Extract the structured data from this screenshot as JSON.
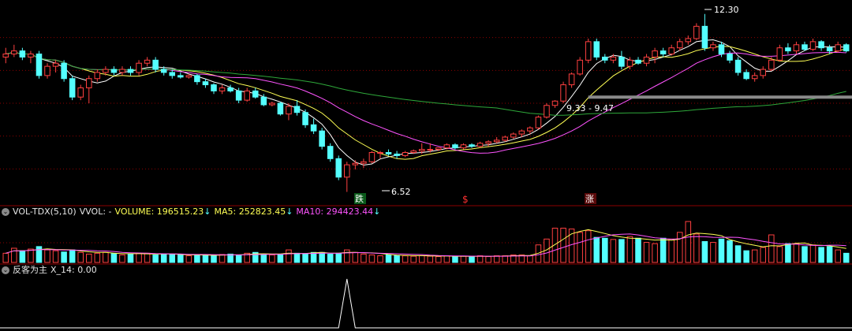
{
  "volume_panel": {
    "title": "VOL-TDX(5,10)",
    "vvol": "VVOL: -",
    "volume": "VOLUME: 196515.23",
    "ma5": "MA5: 252823.45",
    "ma10": "MA10: 294423.44",
    "arrow": "↓",
    "colors": {
      "title": "#e6e6e6",
      "volume": "#ffff54",
      "ma5": "#ffff54",
      "ma10": "#ff54ff",
      "arrow": "#54ffff"
    }
  },
  "signal_panel": {
    "title": "反客为主",
    "value": "X_14: 0.00"
  },
  "annotations": {
    "high_label": "12.30",
    "low_label": "6.52",
    "range_label": "9.33 - 9.47",
    "marker_down": "跌",
    "marker_dollar": "$",
    "marker_up": "涨"
  },
  "colors": {
    "up": "#ff4040",
    "down": "#54ffff",
    "ma_white": "#ffffff",
    "ma_yellow": "#ffff54",
    "ma_magenta": "#ff54ff",
    "ma_green": "#2ea83a",
    "grid": "#8b0000"
  },
  "chart_data": {
    "type": "candlestick",
    "price_candles": [
      [
        10.9,
        11.2,
        10.7,
        11.0
      ],
      [
        11.0,
        11.3,
        10.9,
        11.1
      ],
      [
        11.1,
        11.2,
        10.8,
        10.9
      ],
      [
        10.9,
        11.1,
        10.7,
        11.0
      ],
      [
        11.0,
        11.1,
        10.2,
        10.3
      ],
      [
        10.3,
        10.7,
        10.2,
        10.6
      ],
      [
        10.6,
        10.8,
        10.4,
        10.7
      ],
      [
        10.7,
        10.8,
        10.1,
        10.2
      ],
      [
        10.2,
        10.3,
        9.5,
        9.6
      ],
      [
        9.6,
        10.0,
        9.5,
        9.9
      ],
      [
        9.9,
        10.3,
        9.4,
        10.2
      ],
      [
        10.2,
        10.5,
        10.1,
        10.4
      ],
      [
        10.4,
        10.6,
        10.3,
        10.5
      ],
      [
        10.5,
        10.6,
        10.3,
        10.4
      ],
      [
        10.4,
        10.6,
        10.3,
        10.5
      ],
      [
        10.5,
        10.6,
        10.3,
        10.4
      ],
      [
        10.4,
        10.8,
        10.3,
        10.7
      ],
      [
        10.7,
        10.9,
        10.6,
        10.8
      ],
      [
        10.8,
        10.9,
        10.4,
        10.5
      ],
      [
        10.5,
        10.6,
        10.3,
        10.4
      ],
      [
        10.4,
        10.5,
        10.2,
        10.3
      ],
      [
        10.3,
        10.4,
        10.2,
        10.25
      ],
      [
        10.25,
        10.35,
        10.2,
        10.3
      ],
      [
        10.3,
        10.35,
        10.0,
        10.1
      ],
      [
        10.1,
        10.2,
        9.9,
        10.0
      ],
      [
        10.0,
        10.05,
        9.7,
        9.8
      ],
      [
        9.8,
        10.0,
        9.7,
        9.9
      ],
      [
        9.9,
        10.0,
        9.75,
        9.8
      ],
      [
        9.8,
        9.9,
        9.4,
        9.5
      ],
      [
        9.5,
        9.9,
        9.45,
        9.8
      ],
      [
        9.8,
        9.9,
        9.55,
        9.6
      ],
      [
        9.6,
        9.7,
        9.3,
        9.35
      ],
      [
        9.35,
        9.45,
        9.3,
        9.4
      ],
      [
        9.4,
        9.45,
        9.0,
        9.05
      ],
      [
        9.05,
        9.4,
        8.85,
        9.3
      ],
      [
        9.3,
        9.5,
        9.0,
        9.1
      ],
      [
        9.1,
        9.2,
        8.6,
        8.7
      ],
      [
        8.7,
        8.9,
        8.4,
        8.5
      ],
      [
        8.5,
        8.6,
        7.9,
        8.0
      ],
      [
        8.0,
        8.1,
        7.5,
        7.6
      ],
      [
        7.6,
        7.7,
        6.9,
        7.0
      ],
      [
        7.0,
        7.5,
        6.52,
        7.4
      ],
      [
        7.4,
        7.55,
        7.25,
        7.45
      ],
      [
        7.45,
        7.6,
        7.3,
        7.5
      ],
      [
        7.5,
        7.85,
        7.45,
        7.8
      ],
      [
        7.8,
        7.85,
        7.6,
        7.8
      ],
      [
        7.8,
        7.9,
        7.7,
        7.75
      ],
      [
        7.75,
        7.85,
        7.6,
        7.7
      ],
      [
        7.7,
        7.85,
        7.65,
        7.8
      ],
      [
        7.8,
        7.9,
        7.75,
        7.85
      ],
      [
        7.85,
        8.1,
        7.75,
        7.9
      ],
      [
        7.9,
        8.1,
        7.8,
        7.9
      ],
      [
        7.9,
        7.95,
        7.85,
        7.95
      ],
      [
        7.95,
        8.1,
        7.9,
        8.05
      ],
      [
        8.05,
        8.1,
        7.9,
        7.95
      ],
      [
        7.95,
        8.1,
        7.9,
        8.05
      ],
      [
        8.05,
        8.1,
        7.95,
        8.0
      ],
      [
        8.0,
        8.15,
        7.95,
        8.1
      ],
      [
        8.1,
        8.2,
        8.0,
        8.15
      ],
      [
        8.15,
        8.3,
        8.1,
        8.2
      ],
      [
        8.2,
        8.35,
        8.15,
        8.3
      ],
      [
        8.3,
        8.45,
        8.25,
        8.4
      ],
      [
        8.4,
        8.55,
        8.3,
        8.5
      ],
      [
        8.5,
        8.65,
        8.4,
        8.6
      ],
      [
        8.6,
        9.0,
        8.55,
        8.95
      ],
      [
        8.95,
        9.4,
        8.9,
        9.33
      ],
      [
        9.33,
        9.5,
        9.25,
        9.47
      ],
      [
        9.47,
        10.1,
        9.4,
        10.0
      ],
      [
        10.0,
        10.4,
        9.9,
        10.35
      ],
      [
        10.35,
        10.9,
        10.3,
        10.8
      ],
      [
        10.8,
        11.5,
        10.7,
        11.4
      ],
      [
        11.4,
        11.5,
        10.8,
        10.9
      ],
      [
        10.9,
        11.0,
        10.7,
        10.8
      ],
      [
        10.8,
        11.0,
        10.7,
        10.9
      ],
      [
        10.9,
        11.1,
        10.5,
        10.6
      ],
      [
        10.6,
        10.9,
        10.5,
        10.8
      ],
      [
        10.8,
        10.9,
        10.65,
        10.7
      ],
      [
        10.7,
        11.0,
        10.6,
        10.9
      ],
      [
        10.9,
        11.2,
        10.7,
        11.1
      ],
      [
        11.1,
        11.2,
        10.9,
        11.0
      ],
      [
        11.0,
        11.3,
        10.95,
        11.2
      ],
      [
        11.2,
        11.5,
        11.1,
        11.4
      ],
      [
        11.4,
        11.6,
        11.3,
        11.5
      ],
      [
        11.5,
        12.0,
        11.45,
        11.9
      ],
      [
        11.9,
        12.3,
        11.1,
        11.2
      ],
      [
        11.2,
        11.4,
        11.1,
        11.3
      ],
      [
        11.3,
        11.4,
        10.9,
        11.0
      ],
      [
        11.0,
        11.1,
        10.7,
        10.8
      ],
      [
        10.8,
        10.9,
        10.3,
        10.4
      ],
      [
        10.4,
        10.5,
        10.15,
        10.2
      ],
      [
        10.2,
        10.4,
        10.1,
        10.3
      ],
      [
        10.3,
        10.6,
        10.2,
        10.5
      ],
      [
        10.5,
        10.9,
        10.45,
        10.8
      ],
      [
        10.8,
        11.3,
        10.75,
        11.2
      ],
      [
        11.2,
        11.35,
        11.0,
        11.1
      ],
      [
        11.1,
        11.4,
        11.0,
        11.3
      ],
      [
        11.3,
        11.4,
        11.1,
        11.15
      ],
      [
        11.15,
        11.5,
        11.1,
        11.4
      ],
      [
        11.4,
        11.45,
        11.1,
        11.2
      ],
      [
        11.2,
        11.3,
        11.0,
        11.1
      ],
      [
        11.1,
        11.4,
        11.05,
        11.3
      ],
      [
        11.3,
        11.35,
        11.05,
        11.1
      ]
    ],
    "price_ylim": [
      6.2,
      12.6
    ],
    "volume": [
      0.22,
      0.34,
      0.28,
      0.32,
      0.38,
      0.3,
      0.28,
      0.25,
      0.3,
      0.24,
      0.2,
      0.22,
      0.24,
      0.21,
      0.18,
      0.2,
      0.22,
      0.22,
      0.18,
      0.2,
      0.19,
      0.18,
      0.16,
      0.18,
      0.18,
      0.16,
      0.19,
      0.2,
      0.18,
      0.22,
      0.24,
      0.2,
      0.18,
      0.18,
      0.3,
      0.22,
      0.2,
      0.24,
      0.24,
      0.2,
      0.22,
      0.3,
      0.24,
      0.2,
      0.18,
      0.16,
      0.18,
      0.16,
      0.16,
      0.15,
      0.16,
      0.15,
      0.14,
      0.16,
      0.14,
      0.15,
      0.14,
      0.16,
      0.14,
      0.16,
      0.16,
      0.18,
      0.18,
      0.16,
      0.42,
      0.56,
      0.82,
      0.82,
      0.8,
      0.72,
      0.76,
      0.6,
      0.58,
      0.55,
      0.55,
      0.62,
      0.58,
      0.48,
      0.45,
      0.58,
      0.56,
      0.72,
      0.98,
      0.68,
      0.5,
      0.48,
      0.56,
      0.52,
      0.4,
      0.28,
      0.3,
      0.36,
      0.66,
      0.38,
      0.45,
      0.45,
      0.38,
      0.42,
      0.36,
      0.38,
      0.3,
      0.22
    ],
    "signal_spike_index": 41
  }
}
